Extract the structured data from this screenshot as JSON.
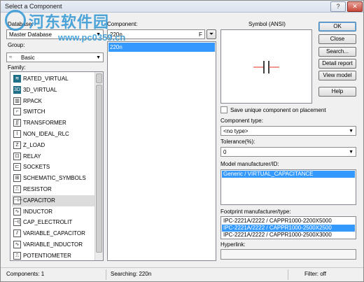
{
  "window": {
    "title": "Select a Component"
  },
  "titlebar": {
    "help_glyph": "?",
    "close_glyph": "✕"
  },
  "left": {
    "database_label": "Database:",
    "database_value": "Master Database",
    "group_label": "Group:",
    "group_value": "Basic",
    "family_label": "Family:",
    "families": [
      {
        "label": "RATED_VIRTUAL",
        "icon": "rated-virtual-icon",
        "glyph": "≋"
      },
      {
        "label": "3D_VIRTUAL",
        "icon": "3d-virtual-icon",
        "glyph": "3D"
      },
      {
        "label": "RPACK",
        "icon": "rpack-icon",
        "glyph": "▥"
      },
      {
        "label": "SWITCH",
        "icon": "switch-icon",
        "glyph": "⌐"
      },
      {
        "label": "TRANSFORMER",
        "icon": "transformer-icon",
        "glyph": "∬"
      },
      {
        "label": "NON_IDEAL_RLC",
        "icon": "non-ideal-rlc-icon",
        "glyph": "⌇"
      },
      {
        "label": "Z_LOAD",
        "icon": "z-load-icon",
        "glyph": "Z"
      },
      {
        "label": "RELAY",
        "icon": "relay-icon",
        "glyph": "⊡"
      },
      {
        "label": "SOCKETS",
        "icon": "sockets-icon",
        "glyph": "⊏"
      },
      {
        "label": "SCHEMATIC_SYMBOLS",
        "icon": "schematic-symbols-icon",
        "glyph": "⊞"
      },
      {
        "label": "RESISTOR",
        "icon": "resistor-icon",
        "glyph": "⎍"
      },
      {
        "label": "CAPACITOR",
        "icon": "capacitor-icon",
        "glyph": "⊣⊢"
      },
      {
        "label": "INDUCTOR",
        "icon": "inductor-icon",
        "glyph": "∿"
      },
      {
        "label": "CAP_ELECTROLIT",
        "icon": "cap-electrolit-icon",
        "glyph": "⊣("
      },
      {
        "label": "VARIABLE_CAPACITOR",
        "icon": "variable-capacitor-icon",
        "glyph": "⫽"
      },
      {
        "label": "VARIABLE_INDUCTOR",
        "icon": "variable-inductor-icon",
        "glyph": "∿"
      },
      {
        "label": "POTENTIOMETER",
        "icon": "potentiometer-icon",
        "glyph": "⎍"
      }
    ]
  },
  "middle": {
    "component_label": "Component:",
    "component_value": "220n",
    "filter_glyph": "F",
    "components": [
      "220n"
    ]
  },
  "right": {
    "symbol_label": "Symbol (ANSI)",
    "save_unique_label": "Save unique component on placement",
    "component_type_label": "Component type:",
    "component_type_value": "<no type>",
    "tolerance_label": "Tolerance(%):",
    "tolerance_value": "0",
    "manufacturer_label": "Model manufacturer/ID:",
    "manufacturer_items": [
      "Generic / VIRTUAL_CAPACITANCE"
    ],
    "footprint_label": "Footprint manufacturer/type:",
    "footprint_items": [
      "IPC-2221A/2222 / CAPPR1000-2200X5000",
      "IPC-2221A/2222 / CAPPR1000-2500X2500",
      "IPC-2221A/2222 / CAPPR1000-2500X3000"
    ],
    "hyperlink_label": "Hyperlink:"
  },
  "buttons": {
    "ok": "OK",
    "close": "Close",
    "search": "Search...",
    "detail_report": "Detail report",
    "view_model": "View model",
    "help": "Help"
  },
  "status": {
    "components": "Components: 1",
    "searching": "Searching: 220n",
    "filter": "Filter: off"
  },
  "watermark": {
    "cn": "河东软件园",
    "url": "www.pc0359.cn"
  },
  "colors": {
    "selection": "#3399ff",
    "watermark": "#2f96d4"
  }
}
